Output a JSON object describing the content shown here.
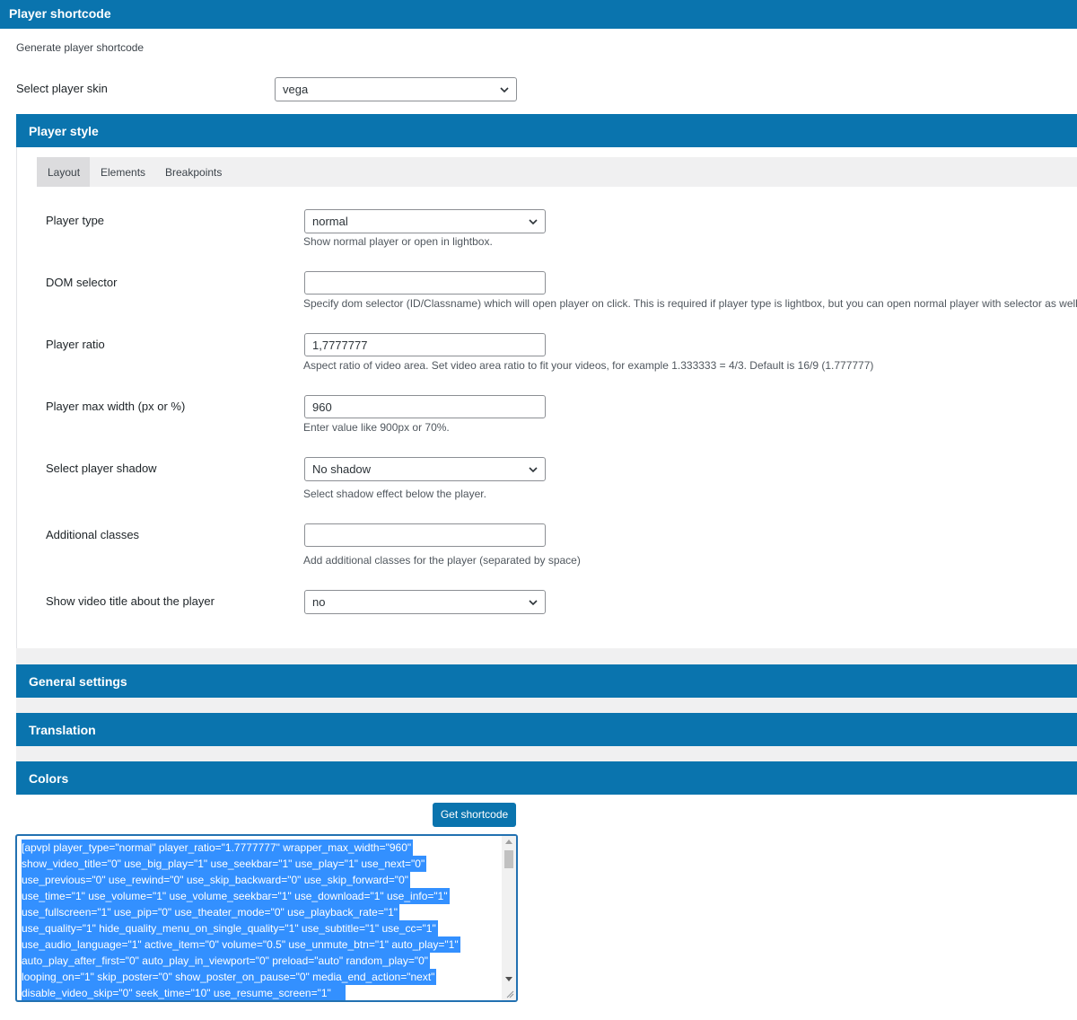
{
  "header": {
    "title": "Player shortcode"
  },
  "intro": {
    "subtitle": "Generate player shortcode"
  },
  "skin": {
    "label": "Select player skin",
    "value": "vega"
  },
  "player_style": {
    "title": "Player style",
    "tabs": [
      {
        "label": "Layout",
        "active": true
      },
      {
        "label": "Elements",
        "active": false
      },
      {
        "label": "Breakpoints",
        "active": false
      }
    ],
    "fields": {
      "player_type": {
        "label": "Player type",
        "value": "normal",
        "hint": "Show normal player or open in lightbox."
      },
      "dom_selector": {
        "label": "DOM selector",
        "value": "",
        "hint": "Specify dom selector (ID/Classname) which will open player on click. This is required if player type is lightbox, but you can open normal player with selector as well."
      },
      "player_ratio": {
        "label": "Player ratio",
        "value": "1,7777777",
        "hint": "Aspect ratio of video area. Set video area ratio to fit your videos, for example 1.333333 = 4/3. Default is 16/9 (1.777777)"
      },
      "max_width": {
        "label": "Player max width (px or %)",
        "value": "960",
        "hint": "Enter value like 900px or 70%."
      },
      "shadow": {
        "label": "Select player shadow",
        "value": "No shadow",
        "hint": "Select shadow effect below the player."
      },
      "classes": {
        "label": "Additional classes",
        "value": "",
        "hint": "Add additional classes for the player (separated by space)"
      },
      "show_title": {
        "label": "Show video title about the player",
        "value": "no"
      }
    }
  },
  "sections": {
    "general": "General settings",
    "translation": "Translation",
    "colors": "Colors"
  },
  "actions": {
    "get_shortcode": "Get shortcode"
  },
  "shortcode": {
    "lines": [
      "[apvpl player_type=\"normal\" player_ratio=\"1.7777777\" wrapper_max_width=\"960\"",
      "show_video_title=\"0\" use_big_play=\"1\" use_seekbar=\"1\" use_play=\"1\" use_next=\"0\"",
      "use_previous=\"0\" use_rewind=\"0\" use_skip_backward=\"0\" use_skip_forward=\"0\"",
      "use_time=\"1\" use_volume=\"1\" use_volume_seekbar=\"1\" use_download=\"1\" use_info=\"1\"",
      "use_fullscreen=\"1\" use_pip=\"0\" use_theater_mode=\"0\" use_playback_rate=\"1\"",
      "use_quality=\"1\" hide_quality_menu_on_single_quality=\"1\" use_subtitle=\"1\" use_cc=\"1\"",
      "use_audio_language=\"1\" active_item=\"0\" volume=\"0.5\" use_unmute_btn=\"1\" auto_play=\"1\"",
      "auto_play_after_first=\"0\" auto_play_in_viewport=\"0\" preload=\"auto\" random_play=\"0\"",
      "looping_on=\"1\" skip_poster=\"0\" show_poster_on_pause=\"0\" media_end_action=\"next\"",
      "disable_video_skip=\"0\" seek_time=\"10\" use_resume_screen=\"1\""
    ]
  },
  "colors": {
    "accent": "#0a74ae",
    "selection": "#3390ff"
  }
}
